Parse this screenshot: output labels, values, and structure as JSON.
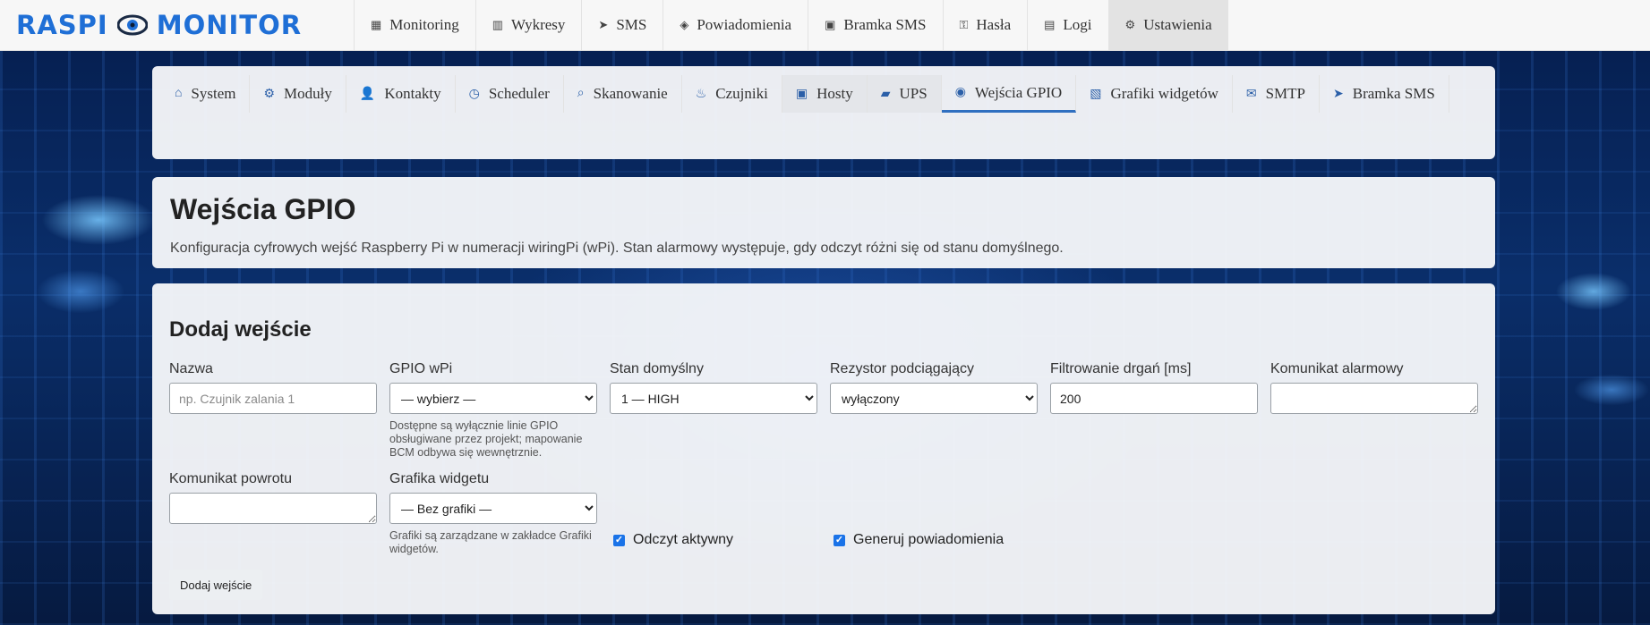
{
  "logo": {
    "left": "RASPI",
    "right": "MONITOR"
  },
  "topnav": [
    {
      "icon": "grid-icon",
      "glyph": "▦",
      "label": "Monitoring"
    },
    {
      "icon": "chart-icon",
      "glyph": "▥",
      "label": "Wykresy"
    },
    {
      "icon": "send-icon",
      "glyph": "➤",
      "label": "SMS"
    },
    {
      "icon": "diamond-icon",
      "glyph": "◈",
      "label": "Powiadomienia"
    },
    {
      "icon": "box-icon",
      "glyph": "▣",
      "label": "Bramka SMS"
    },
    {
      "icon": "key-icon",
      "glyph": "⚿",
      "label": "Hasła"
    },
    {
      "icon": "list-icon",
      "glyph": "▤",
      "label": "Logi"
    },
    {
      "icon": "gear-icon",
      "glyph": "⚙",
      "label": "Ustawienia",
      "active": true
    }
  ],
  "subnav": [
    {
      "icon": "home-icon",
      "glyph": "⌂",
      "label": "System"
    },
    {
      "icon": "module-icon",
      "glyph": "⚙",
      "label": "Moduły"
    },
    {
      "icon": "user-icon",
      "glyph": "👤",
      "label": "Kontakty"
    },
    {
      "icon": "clock-icon",
      "glyph": "◷",
      "label": "Scheduler"
    },
    {
      "icon": "search-icon",
      "glyph": "⌕",
      "label": "Skanowanie"
    },
    {
      "icon": "sensor-icon",
      "glyph": "♨",
      "label": "Czujniki"
    },
    {
      "icon": "host-icon",
      "glyph": "▣",
      "label": "Hosty",
      "shaded": true
    },
    {
      "icon": "battery-icon",
      "glyph": "▰",
      "label": "UPS",
      "shaded": true
    },
    {
      "icon": "gpio-icon",
      "glyph": "◉",
      "label": "Wejścia GPIO",
      "active": true
    },
    {
      "icon": "image-icon",
      "glyph": "▧",
      "label": "Grafiki widgetów"
    },
    {
      "icon": "mail-icon",
      "glyph": "✉",
      "label": "SMTP"
    },
    {
      "icon": "send-icon",
      "glyph": "➤",
      "label": "Bramka SMS"
    }
  ],
  "page": {
    "title": "Wejścia GPIO",
    "description": "Konfiguracja cyfrowych wejść Raspberry Pi w numeracji wiringPi (wPi). Stan alarmowy występuje, gdy odczyt różni się od stanu domyślnego."
  },
  "form": {
    "heading": "Dodaj wejście",
    "name_label": "Nazwa",
    "name_placeholder": "np. Czujnik zalania 1",
    "gpio_label": "GPIO wPi",
    "gpio_value": "— wybierz —",
    "gpio_help": "Dostępne są wyłącznie linie GPIO obsługiwane przez projekt; mapowanie BCM odbywa się wewnętrznie.",
    "default_label": "Stan domyślny",
    "default_value": "1 — HIGH",
    "pullup_label": "Rezystor podciągający",
    "pullup_value": "wyłączony",
    "debounce_label": "Filtrowanie drgań [ms]",
    "debounce_value": "200",
    "alarm_label": "Komunikat alarmowy",
    "return_label": "Komunikat powrotu",
    "graphic_label": "Grafika widgetu",
    "graphic_value": "— Bez grafiki —",
    "graphic_help": "Grafiki są zarządzane w zakładce Grafiki widgetów.",
    "read_active_label": "Odczyt aktywny",
    "notify_label": "Generuj powiadomienia",
    "submit_label": "Dodaj wejście"
  }
}
